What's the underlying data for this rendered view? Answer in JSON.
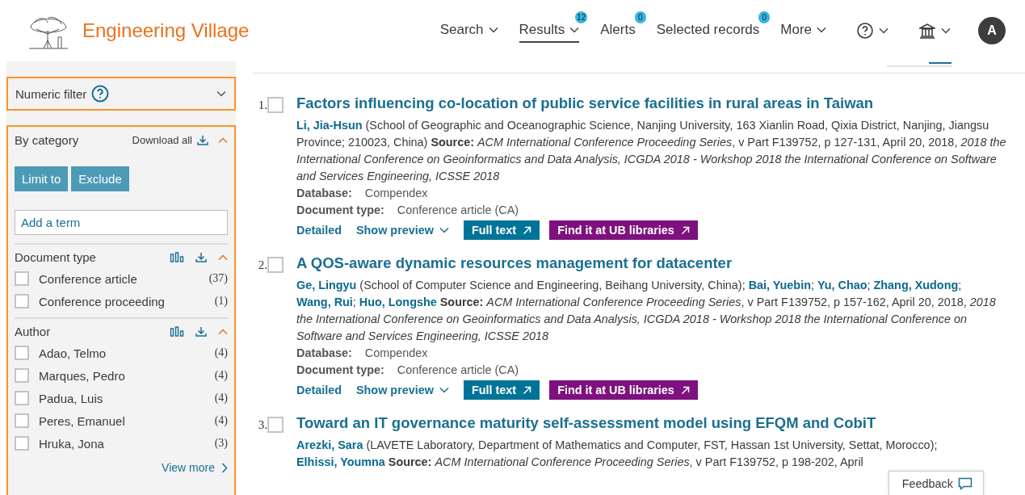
{
  "header": {
    "logo_text": "Engineering Village",
    "nav": [
      {
        "label": "Search",
        "selected": false,
        "caret": true
      },
      {
        "label": "Results",
        "selected": true,
        "caret": true,
        "badge": "12"
      },
      {
        "label": "Alerts",
        "selected": false,
        "caret": false,
        "badge": "0"
      },
      {
        "label": "Selected records",
        "selected": false,
        "caret": false,
        "badge": "0"
      },
      {
        "label": "More",
        "selected": false,
        "caret": true
      }
    ],
    "avatar": "A"
  },
  "sidebar": {
    "numeric_filter": {
      "label": "Numeric filter",
      "expanded": false
    },
    "category": {
      "title": "By category",
      "download_label": "Download all",
      "expanded": true,
      "buttons": [
        "Limit to",
        "Exclude"
      ],
      "term_placeholder": "Add a term",
      "facets": [
        {
          "title": "Document type",
          "expanded": true,
          "items": [
            {
              "label": "Conference article",
              "count": "(37)",
              "checked": false
            },
            {
              "label": "Conference proceeding",
              "count": "(1)",
              "checked": false
            }
          ]
        },
        {
          "title": "Author",
          "expanded": true,
          "items": [
            {
              "label": "Adao, Telmo",
              "count": "(4)",
              "checked": false
            },
            {
              "label": "Marques, Pedro",
              "count": "(4)",
              "checked": false
            },
            {
              "label": "Padua, Luis",
              "count": "(4)",
              "checked": false
            },
            {
              "label": "Peres, Emanuel",
              "count": "(4)",
              "checked": false
            },
            {
              "label": "Hruka, Jona",
              "count": "(3)",
              "checked": false
            }
          ]
        }
      ],
      "view_more": "View more"
    }
  },
  "results": [
    {
      "number": "1.",
      "checked": false,
      "title": "Factors influencing co-location of public service facilities in rural areas in Taiwan",
      "authors": [
        {
          "name": "Li, Jia-Hsun",
          "affiliation": "(School of Geographic and Oceanographic Science, Nanjing University, 163 Xianlin Road, Qixia District, Nanjing, Jiangsu Province; 210023, China)"
        }
      ],
      "source": "**Source:** *ACM International Conference Proceeding Series*, v Part F139752, p 127-131, April 20, 2018, *2018 the International Conference on Geoinformatics and Data Analysis, ICGDA 2018 - Workshop 2018 the International Conference on Software and Services Engineering, ICSSE 2018*",
      "database_label": "Database:",
      "database": "Compendex",
      "doctype_label": "Document type:",
      "doctype": "Conference article (CA)",
      "links": {
        "detailed": "Detailed",
        "preview": "Show preview",
        "full_text": "Full text",
        "library": "Find it at UB libraries"
      }
    },
    {
      "number": "2.",
      "checked": false,
      "separator": ";",
      "title": "A QOS-aware dynamic resources management for datacenter",
      "authors": [
        {
          "name": "Ge, Lingyu",
          "affiliation": "(School of Computer Science and Engineering, Beihang University, China)"
        },
        {
          "name": "Bai, Yuebin"
        },
        {
          "name": "Yu, Chao"
        },
        {
          "name": "Zhang, Xudong"
        },
        {
          "name": "Wang, Rui"
        },
        {
          "name": "Huo, Longshe"
        }
      ],
      "source": "**Source:** *ACM International Conference Proceeding Series*, v Part F139752, p 157-162, April 20, 2018, *2018 the International Conference on Geoinformatics and Data Analysis, ICGDA 2018 - Workshop 2018 the International Conference on Software and Services Engineering, ICSSE 2018*",
      "database_label": "Database:",
      "database": "Compendex",
      "doctype_label": "Document type:",
      "doctype": "Conference article (CA)",
      "links": {
        "detailed": "Detailed",
        "preview": "Show preview",
        "full_text": "Full text",
        "library": "Find it at UB libraries"
      }
    },
    {
      "number": "3.",
      "checked": false,
      "separator": ";",
      "title": "Toward an IT governance maturity self-assessment model using EFQM and CobiT",
      "authors": [
        {
          "name": "Arezki, Sara",
          "affiliation": "(LAVETE Laboratory, Department of Mathematics and Computer, FST, Hassan 1st University, Settat, Morocco)"
        },
        {
          "name": "Elhissi, Youmna"
        }
      ],
      "source": "**Source:** *ACM International Conference Proceeding Series*, v Part F139752, p 198-202, April"
    }
  ],
  "feedback": {
    "label": "Feedback"
  }
}
